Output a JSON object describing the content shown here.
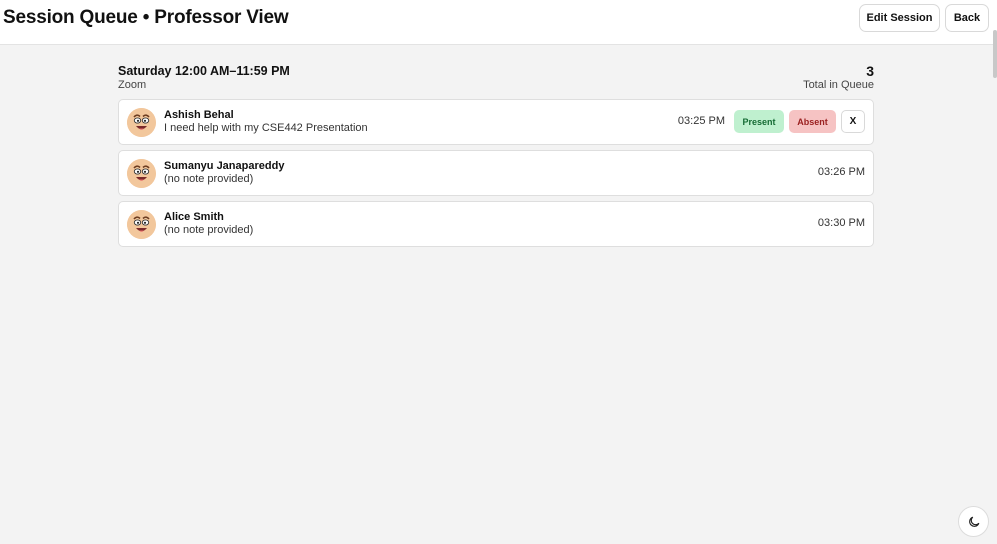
{
  "header": {
    "title": "Session Queue • Professor View",
    "edit_label": "Edit Session",
    "back_label": "Back"
  },
  "session": {
    "time": "Saturday 12:00 AM–11:59 PM",
    "location": "Zoom",
    "queue_count": "3",
    "queue_label": "Total in Queue"
  },
  "queue": [
    {
      "name": "Ashish Behal",
      "note": "I need help with my CSE442 Presentation",
      "time": "03:25 PM",
      "actions": {
        "present_label": "Present",
        "absent_label": "Absent",
        "remove_label": "X"
      }
    },
    {
      "name": "Sumanyu Janapareddy",
      "note": "(no note provided)",
      "time": "03:26 PM"
    },
    {
      "name": "Alice Smith",
      "note": "(no note provided)",
      "time": "03:30 PM"
    }
  ],
  "colors": {
    "present_bg": "#bff0cf",
    "present_text": "#156b34",
    "absent_bg": "#f6c3c3",
    "absent_text": "#9b2121"
  },
  "icons": {
    "avatar": "cartoon-face-avatar-icon",
    "theme_toggle": "moon-icon"
  }
}
